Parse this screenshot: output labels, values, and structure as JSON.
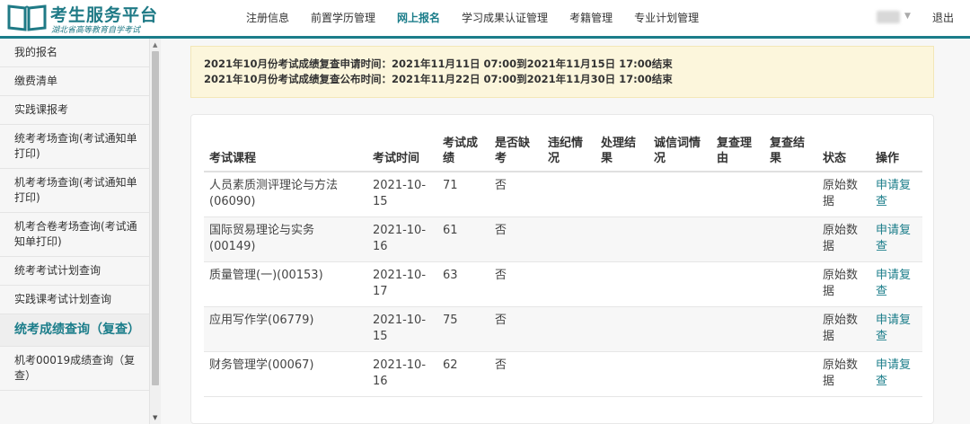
{
  "logo": {
    "title": "考生服务平台",
    "subtitle": "湖北省高等教育自学考试"
  },
  "nav": {
    "items": [
      {
        "label": "注册信息"
      },
      {
        "label": "前置学历管理"
      },
      {
        "label": "网上报名"
      },
      {
        "label": "学习成果认证管理"
      },
      {
        "label": "考籍管理"
      },
      {
        "label": "专业计划管理"
      }
    ],
    "active_index": 2,
    "logout_label": "退出"
  },
  "sidebar": {
    "items": [
      {
        "label": "我的报名"
      },
      {
        "label": "缴费清单"
      },
      {
        "label": "实践课报考"
      },
      {
        "label": "统考考场查询(考试通知单打印)"
      },
      {
        "label": "机考考场查询(考试通知单打印)"
      },
      {
        "label": "机考合卷考场查询(考试通知单打印)"
      },
      {
        "label": "统考考试计划查询"
      },
      {
        "label": "实践课考试计划查询"
      },
      {
        "label": "统考成绩查询（复查）"
      },
      {
        "label": "机考00019成绩查询（复查）"
      }
    ],
    "active_index": 8
  },
  "notice": {
    "line1": "2021年10月份考试成绩复查申请时间：2021年11月11日 07:00到2021年11月15日 17:00结束",
    "line2": "2021年10月份考试成绩复查公布时间：2021年11月22日 07:00到2021年11月30日 17:00结束"
  },
  "table": {
    "headers": {
      "course": "考试课程",
      "time": "考试时间",
      "score": "考试成绩",
      "absent": "是否缺考",
      "violation": "违纪情况",
      "result": "处理结果",
      "integrity": "诚信词情况",
      "review_reason": "复查理由",
      "review_result": "复查结果",
      "status": "状态",
      "action": "操作"
    },
    "rows": [
      {
        "course": "人员素质测评理论与方法(06090)",
        "time": "2021-10-15",
        "score": "71",
        "absent": "否",
        "status": "原始数据",
        "action": "申请复查"
      },
      {
        "course": "国际贸易理论与实务(00149)",
        "time": "2021-10-16",
        "score": "61",
        "absent": "否",
        "status": "原始数据",
        "action": "申请复查"
      },
      {
        "course": "质量管理(一)(00153)",
        "time": "2021-10-17",
        "score": "63",
        "absent": "否",
        "status": "原始数据",
        "action": "申请复查"
      },
      {
        "course": "应用写作学(06779)",
        "time": "2021-10-15",
        "score": "75",
        "absent": "否",
        "status": "原始数据",
        "action": "申请复查"
      },
      {
        "course": "财务管理学(00067)",
        "time": "2021-10-16",
        "score": "62",
        "absent": "否",
        "status": "原始数据",
        "action": "申请复查"
      }
    ]
  },
  "colors": {
    "brand": "#1b7d8a",
    "notice_bg": "#fcf6dc"
  }
}
